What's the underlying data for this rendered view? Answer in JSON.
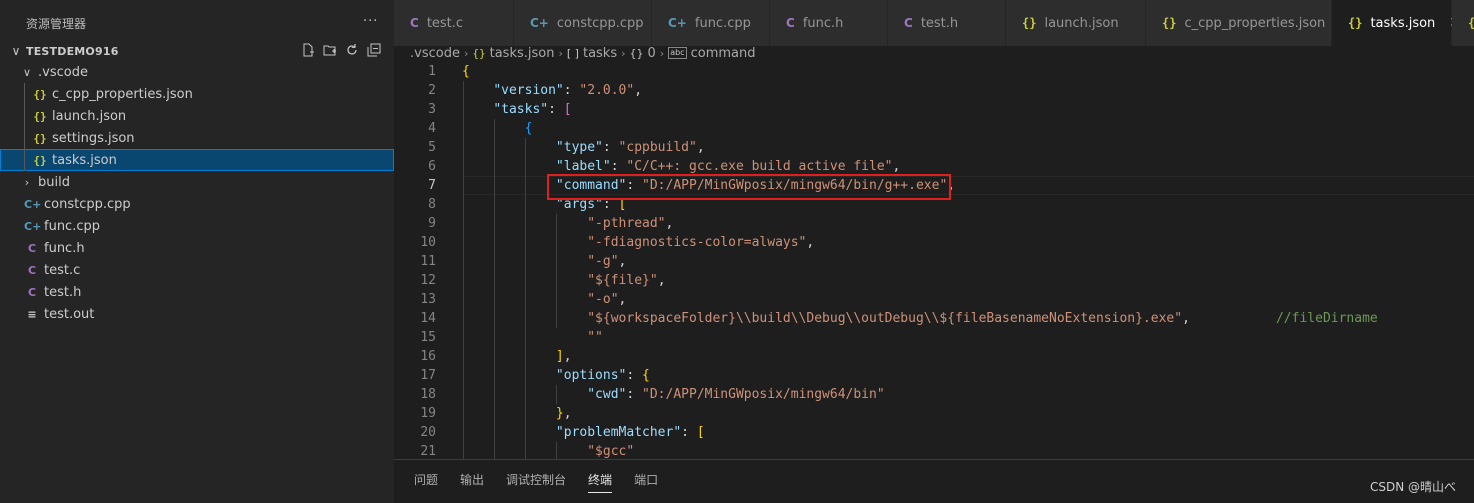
{
  "sidebar": {
    "title": "资源管理器",
    "more_label": "···",
    "workspace": "TESTDEMO916",
    "tree": [
      {
        "label": ".vscode",
        "type": "folder",
        "expanded": true,
        "depth": 1
      },
      {
        "label": "c_cpp_properties.json",
        "type": "json",
        "depth": 2
      },
      {
        "label": "launch.json",
        "type": "json",
        "depth": 2
      },
      {
        "label": "settings.json",
        "type": "json",
        "depth": 2
      },
      {
        "label": "tasks.json",
        "type": "json",
        "depth": 2,
        "selected": true
      },
      {
        "label": "build",
        "type": "folder",
        "expanded": false,
        "depth": 1
      },
      {
        "label": "constcpp.cpp",
        "type": "cpp",
        "depth": 1
      },
      {
        "label": "func.cpp",
        "type": "cpp",
        "depth": 1
      },
      {
        "label": "func.h",
        "type": "c",
        "depth": 1
      },
      {
        "label": "test.c",
        "type": "c",
        "depth": 1
      },
      {
        "label": "test.h",
        "type": "c",
        "depth": 1
      },
      {
        "label": "test.out",
        "type": "out",
        "depth": 1
      }
    ]
  },
  "tabs": [
    {
      "label": "test.c",
      "type": "c"
    },
    {
      "label": "constcpp.cpp",
      "type": "cpp"
    },
    {
      "label": "func.cpp",
      "type": "cpp"
    },
    {
      "label": "func.h",
      "type": "c"
    },
    {
      "label": "test.h",
      "type": "c"
    },
    {
      "label": "launch.json",
      "type": "json"
    },
    {
      "label": "c_cpp_properties.json",
      "type": "json"
    },
    {
      "label": "tasks.json",
      "type": "json",
      "active": true
    },
    {
      "label": "",
      "type": "json"
    }
  ],
  "breadcrumb": {
    "folder": ".vscode",
    "file": "tasks.json",
    "array": "tasks",
    "index": "0",
    "key": "command"
  },
  "code_lines": [
    {
      "n": "1",
      "tokens": [
        [
          "b1",
          "{"
        ]
      ]
    },
    {
      "n": "2",
      "tokens": [
        [
          "p",
          "    "
        ],
        [
          "k",
          "\"version\""
        ],
        [
          "p",
          ": "
        ],
        [
          "s",
          "\"2.0.0\""
        ],
        [
          "p",
          ","
        ]
      ]
    },
    {
      "n": "3",
      "tokens": [
        [
          "p",
          "    "
        ],
        [
          "k",
          "\"tasks\""
        ],
        [
          "p",
          ": "
        ],
        [
          "b2",
          "["
        ]
      ]
    },
    {
      "n": "4",
      "tokens": [
        [
          "p",
          "        "
        ],
        [
          "b3",
          "{"
        ]
      ]
    },
    {
      "n": "5",
      "tokens": [
        [
          "p",
          "            "
        ],
        [
          "k",
          "\"type\""
        ],
        [
          "p",
          ": "
        ],
        [
          "s",
          "\"cppbuild\""
        ],
        [
          "p",
          ","
        ]
      ]
    },
    {
      "n": "6",
      "tokens": [
        [
          "p",
          "            "
        ],
        [
          "k",
          "\"label\""
        ],
        [
          "p",
          ": "
        ],
        [
          "s",
          "\"C/C++: gcc.exe build active file\""
        ],
        [
          "p",
          ","
        ]
      ]
    },
    {
      "n": "7",
      "tokens": [
        [
          "p",
          "            "
        ],
        [
          "k",
          "\"command\""
        ],
        [
          "p",
          ": "
        ],
        [
          "s",
          "\"D:/APP/MinGWposix/mingw64/bin/g++.exe\""
        ],
        [
          "p",
          ","
        ]
      ]
    },
    {
      "n": "8",
      "tokens": [
        [
          "p",
          "            "
        ],
        [
          "k",
          "\"args\""
        ],
        [
          "p",
          ": "
        ],
        [
          "b1",
          "["
        ]
      ]
    },
    {
      "n": "9",
      "tokens": [
        [
          "p",
          "                "
        ],
        [
          "s",
          "\"-pthread\""
        ],
        [
          "p",
          ","
        ]
      ]
    },
    {
      "n": "10",
      "tokens": [
        [
          "p",
          "                "
        ],
        [
          "s",
          "\"-fdiagnostics-color=always\""
        ],
        [
          "p",
          ","
        ]
      ]
    },
    {
      "n": "11",
      "tokens": [
        [
          "p",
          "                "
        ],
        [
          "s",
          "\"-g\""
        ],
        [
          "p",
          ","
        ]
      ]
    },
    {
      "n": "12",
      "tokens": [
        [
          "p",
          "                "
        ],
        [
          "s",
          "\"${file}\""
        ],
        [
          "p",
          ","
        ]
      ]
    },
    {
      "n": "13",
      "tokens": [
        [
          "p",
          "                "
        ],
        [
          "s",
          "\"-o\""
        ],
        [
          "p",
          ","
        ]
      ]
    },
    {
      "n": "14",
      "tokens": [
        [
          "p",
          "                "
        ],
        [
          "s",
          "\"${workspaceFolder}\\\\build\\\\Debug\\\\outDebug\\\\${fileBasenameNoExtension}.exe\""
        ],
        [
          "p",
          ",           "
        ],
        [
          "c",
          "//fileDirname"
        ]
      ]
    },
    {
      "n": "15",
      "tokens": [
        [
          "p",
          "                "
        ],
        [
          "s",
          "\"\""
        ]
      ]
    },
    {
      "n": "16",
      "tokens": [
        [
          "p",
          "            "
        ],
        [
          "b1",
          "]"
        ],
        [
          "p",
          ","
        ]
      ]
    },
    {
      "n": "17",
      "tokens": [
        [
          "p",
          "            "
        ],
        [
          "k",
          "\"options\""
        ],
        [
          "p",
          ": "
        ],
        [
          "b1",
          "{"
        ]
      ]
    },
    {
      "n": "18",
      "tokens": [
        [
          "p",
          "                "
        ],
        [
          "k",
          "\"cwd\""
        ],
        [
          "p",
          ": "
        ],
        [
          "s",
          "\"D:/APP/MinGWposix/mingw64/bin\""
        ]
      ]
    },
    {
      "n": "19",
      "tokens": [
        [
          "p",
          "            "
        ],
        [
          "b1",
          "}"
        ],
        [
          "p",
          ","
        ]
      ]
    },
    {
      "n": "20",
      "tokens": [
        [
          "p",
          "            "
        ],
        [
          "k",
          "\"problemMatcher\""
        ],
        [
          "p",
          ": "
        ],
        [
          "b1",
          "["
        ]
      ]
    },
    {
      "n": "21",
      "tokens": [
        [
          "p",
          "                "
        ],
        [
          "s",
          "\"$gcc\""
        ]
      ]
    }
  ],
  "active_line": "7",
  "panel": {
    "tabs": [
      {
        "label": "问题"
      },
      {
        "label": "输出"
      },
      {
        "label": "调试控制台"
      },
      {
        "label": "终端",
        "active": true
      },
      {
        "label": "端口"
      }
    ]
  },
  "watermark": "CSDN @晴山べ",
  "colors": {
    "highlight_box": "#e0201c",
    "selection": "#094771",
    "accent": "#007fd4"
  }
}
